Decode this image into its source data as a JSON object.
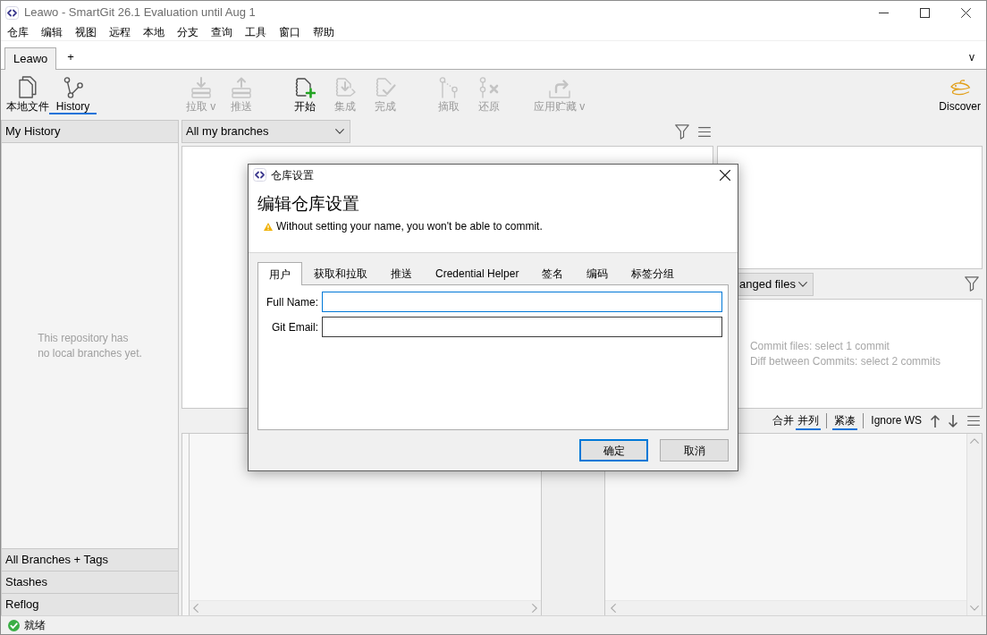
{
  "window": {
    "title": "Leawo - SmartGit 26.1 Evaluation until Aug 1"
  },
  "menu": [
    "仓库",
    "编辑",
    "视图",
    "远程",
    "本地",
    "分支",
    "查询",
    "工具",
    "窗口",
    "帮助"
  ],
  "repository_tabs": {
    "tabs": [
      {
        "label": "Leawo",
        "selected": true
      }
    ],
    "add": "+",
    "overflow": "v"
  },
  "toolbar": {
    "views": [
      {
        "label": "本地文件",
        "selected": false
      },
      {
        "label": "History",
        "selected": true
      }
    ],
    "action_groups": [
      [
        {
          "label": "拉取 v",
          "disabled": true
        },
        {
          "label": "推送",
          "disabled": true
        }
      ],
      [
        {
          "label": "开始",
          "disabled": false
        },
        {
          "label": "集成",
          "disabled": true
        },
        {
          "label": "完成",
          "disabled": true
        }
      ],
      [
        {
          "label": "摘取",
          "disabled": true
        },
        {
          "label": "还原",
          "disabled": true
        }
      ],
      [
        {
          "label": "应用贮藏 v",
          "disabled": true
        }
      ]
    ],
    "discover": "Discover"
  },
  "branches_panel": {
    "title": "My History",
    "empty_text": "This repository has\nno local branches yet.",
    "sections": [
      "All Branches + Tags",
      "Stashes",
      "Reflog"
    ]
  },
  "graph": {
    "branch_filter": "All my branches"
  },
  "files": {
    "view_filter": "anged files",
    "hints": [
      "Commit files: select 1 commit",
      "Diff between Commits: select 2 commits"
    ]
  },
  "diff_toolbar": {
    "groups": [
      [
        {
          "label": "合并",
          "selected": false
        },
        {
          "label": "并列",
          "selected": true
        }
      ],
      [
        {
          "label": "紧凑",
          "selected": true
        }
      ],
      [
        {
          "label": "Ignore WS",
          "selected": false
        }
      ]
    ]
  },
  "status_bar": {
    "text": "就绪"
  },
  "dialog": {
    "title": "仓库设置",
    "heading": "编辑仓库设置",
    "warning": "Without setting your name, you won't be able to commit.",
    "tabs": [
      {
        "label": "用户",
        "selected": true
      },
      {
        "label": "获取和拉取",
        "selected": false
      },
      {
        "label": "推送",
        "selected": false
      },
      {
        "label": "Credential Helper",
        "selected": false
      },
      {
        "label": "签名",
        "selected": false
      },
      {
        "label": "编码",
        "selected": false
      },
      {
        "label": "标签分组",
        "selected": false
      }
    ],
    "fields": [
      {
        "label": "Full Name:",
        "focused": true
      },
      {
        "label": "Git Email:",
        "focused": false
      }
    ],
    "buttons": [
      {
        "label": "确定",
        "default": true
      },
      {
        "label": "取消",
        "default": false
      }
    ]
  }
}
